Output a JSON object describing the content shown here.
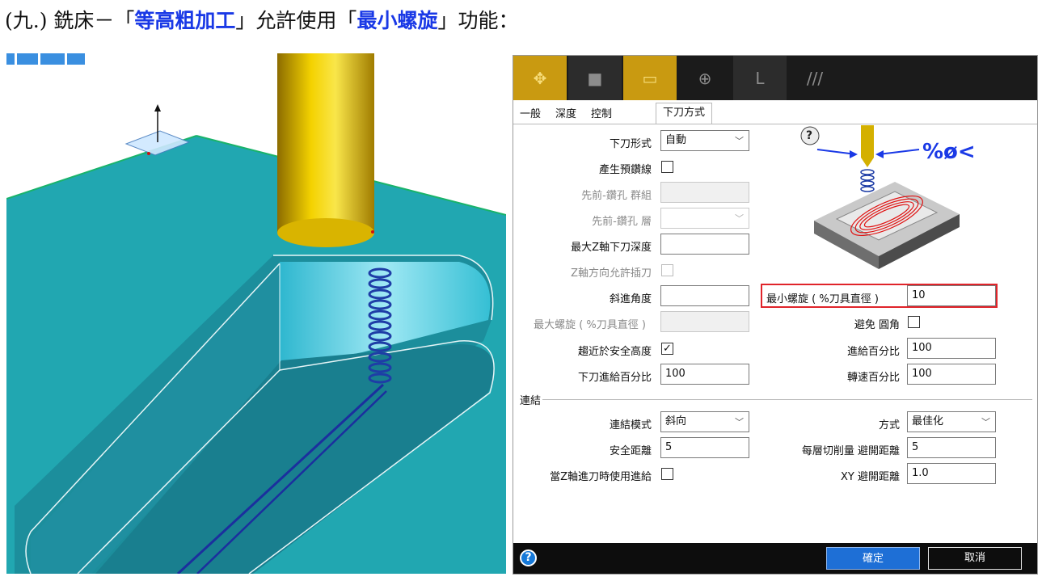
{
  "heading": {
    "prefix": "(九.) 銑床－「",
    "hl1": "等高粗加工",
    "middle": "」允許使用「",
    "hl2": "最小螺旋",
    "suffix": "」功能："
  },
  "dialog": {
    "tabs": [
      "一般",
      "深度",
      "控制",
      "下刀方式"
    ],
    "fields": {
      "entry_type": {
        "label": "下刀形式",
        "value": "自動"
      },
      "gen_predrill": {
        "label": "產生預鑽線"
      },
      "prev_drill_group": {
        "label": "先前-鑽孔 群組"
      },
      "prev_drill_layer": {
        "label": "先前-鑽孔 層"
      },
      "max_z_plunge": {
        "label": "最大Z軸下刀深度",
        "value": ""
      },
      "z_plunge_allow": {
        "label": "Z軸方向允許插刀"
      },
      "ramp_angle": {
        "label": "斜進角度",
        "value": ""
      },
      "max_helix": {
        "label": "最大螺旋 ( %刀具直徑 )"
      },
      "approach_safe": {
        "label": "趨近於安全高度",
        "checked": true
      },
      "plunge_feed_pct": {
        "label": "下刀進給百分比",
        "value": "100"
      },
      "min_helix": {
        "label": "最小螺旋 ( %刀具直徑 )",
        "value": "10"
      },
      "avoid_corner": {
        "label": "避免 圓角"
      },
      "feed_pct": {
        "label": "進給百分比",
        "value": "100"
      },
      "speed_pct": {
        "label": "轉速百分比",
        "value": "100"
      }
    },
    "link_group": {
      "title": "連結",
      "link_mode": {
        "label": "連結模式",
        "value": "斜向"
      },
      "method": {
        "label": "方式",
        "value": "最佳化"
      },
      "safe_dist": {
        "label": "安全距離",
        "value": "5"
      },
      "layer_retract": {
        "label": "每層切削量 避開距離",
        "value": "5"
      },
      "use_feed_z": {
        "label": "當Z軸進刀時使用進給"
      },
      "xy_retract": {
        "label": "XY 避開距離",
        "value": "1.0"
      }
    },
    "diagram": {
      "help_mark": "?",
      "symbol": "%ø<"
    },
    "buttons": {
      "ok": "確定",
      "cancel": "取消",
      "help": "?"
    }
  },
  "colors": {
    "accent_gold": "#c99a11",
    "highlight_red": "#e0242a",
    "ok_blue": "#1e6fd6",
    "heading_blue": "#1a39e6"
  }
}
